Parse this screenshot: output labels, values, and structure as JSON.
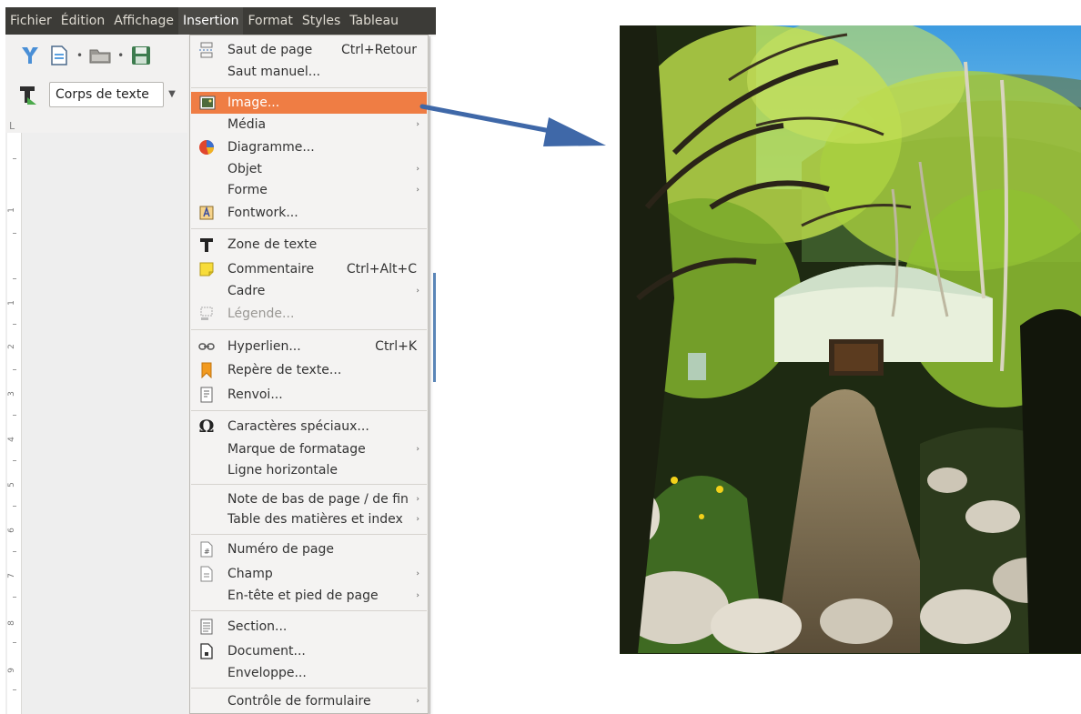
{
  "menubar": {
    "items": [
      "Fichier",
      "Édition",
      "Affichage",
      "Insertion",
      "Format",
      "Styles",
      "Tableau"
    ],
    "active": "Insertion"
  },
  "toolbar": {
    "paragraph_style": "Corps de texte"
  },
  "ruler": {
    "corner": "L",
    "numbers": [
      "1",
      "1",
      "2",
      "3",
      "4",
      "5",
      "6",
      "7",
      "8",
      "9"
    ]
  },
  "insert_menu": {
    "items": [
      {
        "label": "Saut de page",
        "shortcut": "Ctrl+Retour",
        "icon": "page-break-icon"
      },
      {
        "label": "Saut manuel...",
        "icon": ""
      },
      {
        "label": "Image...",
        "icon": "image-icon",
        "highlighted": true
      },
      {
        "label": "Média",
        "submenu": true
      },
      {
        "label": "Diagramme...",
        "icon": "chart-icon"
      },
      {
        "label": "Objet",
        "submenu": true
      },
      {
        "label": "Forme",
        "submenu": true
      },
      {
        "label": "Fontwork...",
        "icon": "fontwork-icon"
      },
      {
        "label": "Zone de texte",
        "icon": "text-box-icon"
      },
      {
        "label": "Commentaire",
        "shortcut": "Ctrl+Alt+C",
        "icon": "comment-icon"
      },
      {
        "label": "Cadre",
        "submenu": true
      },
      {
        "label": "Légende...",
        "icon": "caption-icon",
        "disabled": true
      },
      {
        "label": "Hyperlien...",
        "shortcut": "Ctrl+K",
        "icon": "hyperlink-icon"
      },
      {
        "label": "Repère de texte...",
        "icon": "bookmark-icon"
      },
      {
        "label": "Renvoi...",
        "icon": "cross-reference-icon"
      },
      {
        "label": "Caractères spéciaux...",
        "icon": "omega-icon"
      },
      {
        "label": "Marque de formatage",
        "submenu": true
      },
      {
        "label": "Ligne horizontale"
      },
      {
        "label": "Note de bas de page / de fin",
        "submenu": true
      },
      {
        "label": "Table des matières et index",
        "submenu": true
      },
      {
        "label": "Numéro de page",
        "icon": "page-number-icon"
      },
      {
        "label": "Champ",
        "submenu": true,
        "icon": "field-icon"
      },
      {
        "label": "En-tête et pied de page",
        "submenu": true
      },
      {
        "label": "Section...",
        "icon": "section-icon"
      },
      {
        "label": "Document...",
        "icon": "document-icon"
      },
      {
        "label": "Enveloppe..."
      },
      {
        "label": "Contrôle de formulaire",
        "submenu": true
      }
    ]
  },
  "colors": {
    "menubar_bg": "#3c3b37",
    "highlight": "#ef7d44",
    "arrow": "#3f68a8"
  }
}
